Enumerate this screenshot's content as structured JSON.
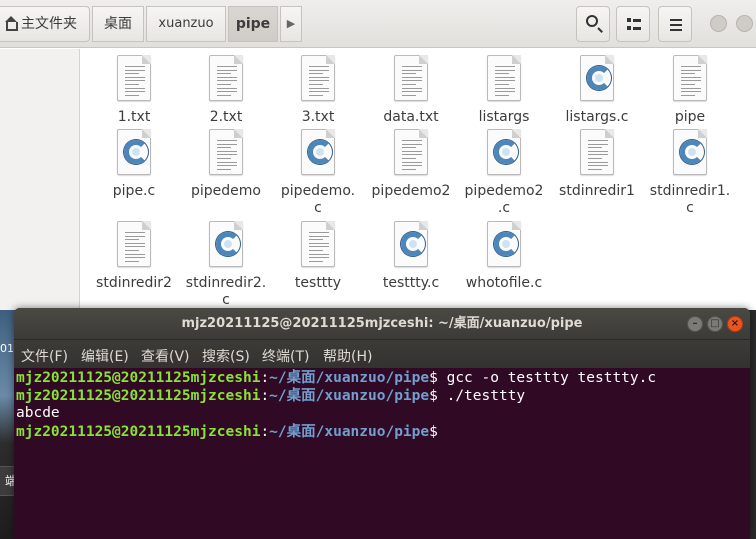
{
  "file_manager": {
    "breadcrumb": {
      "home": "主文件夹",
      "items": [
        "桌面",
        "xuanzuo",
        "pipe"
      ]
    },
    "toolbar_icons": [
      "search-icon",
      "view-toggle-icon",
      "menu-icon"
    ],
    "files": [
      {
        "name": "1.txt",
        "type": "text"
      },
      {
        "name": "2.txt",
        "type": "text"
      },
      {
        "name": "3.txt",
        "type": "text"
      },
      {
        "name": "data.txt",
        "type": "text"
      },
      {
        "name": "listargs",
        "type": "text"
      },
      {
        "name": "listargs.c",
        "type": "c-source"
      },
      {
        "name": "pipe",
        "type": "text"
      },
      {
        "name": "pipe.c",
        "type": "c-source"
      },
      {
        "name": "pipedemo",
        "type": "text"
      },
      {
        "name": "pipedemo.c",
        "type": "c-source"
      },
      {
        "name": "pipedemo2",
        "type": "text"
      },
      {
        "name": "pipedemo2.c",
        "type": "c-source"
      },
      {
        "name": "stdinredir1",
        "type": "text"
      },
      {
        "name": "stdinredir1.c",
        "type": "c-source"
      },
      {
        "name": "stdinredir2",
        "type": "text"
      },
      {
        "name": "stdinredir2.c",
        "type": "c-source"
      },
      {
        "name": "testtty",
        "type": "text"
      },
      {
        "name": "testtty.c",
        "type": "c-source"
      },
      {
        "name": "whotofile.c",
        "type": "c-source"
      }
    ]
  },
  "terminal": {
    "title": "mjz20211125@20211125mjzceshi: ~/桌面/xuanzuo/pipe",
    "menu": [
      "文件(F)",
      "编辑(E)",
      "查看(V)",
      "搜索(S)",
      "终端(T)",
      "帮助(H)"
    ],
    "prompt_user": "mjz20211125@20211125mjzceshi",
    "prompt_path": "~/桌面/xuanzuo/pipe",
    "lines": [
      {
        "kind": "prompt",
        "command": " gcc -o testtty testtty.c"
      },
      {
        "kind": "prompt",
        "command": " ./testtty"
      },
      {
        "kind": "output",
        "text": "abcde"
      },
      {
        "kind": "prompt",
        "command": ""
      }
    ]
  },
  "desktop": {
    "left_label": "01",
    "chip_label": "端"
  }
}
